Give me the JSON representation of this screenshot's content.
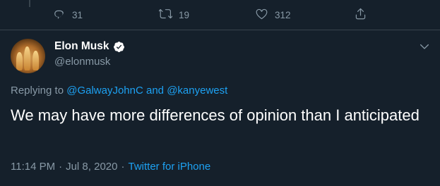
{
  "actions": {
    "reply_count": "31",
    "retweet_count": "19",
    "like_count": "312"
  },
  "tweet": {
    "author": {
      "name": "Elon Musk",
      "handle": "@elonmusk",
      "verified": true
    },
    "replying": {
      "prefix": "Replying to",
      "user1": "@GalwayJohnC",
      "conjunction": "and",
      "user2": "@kanyewest"
    },
    "text": "We may have more differences of opinion than I anticipated",
    "time": "11:14 PM",
    "date": "Jul 8, 2020",
    "separator": "·",
    "source": "Twitter for iPhone"
  },
  "colors": {
    "background": "#15202b",
    "muted": "#8899a6",
    "link": "#1da1f2",
    "divider": "#38444d"
  }
}
